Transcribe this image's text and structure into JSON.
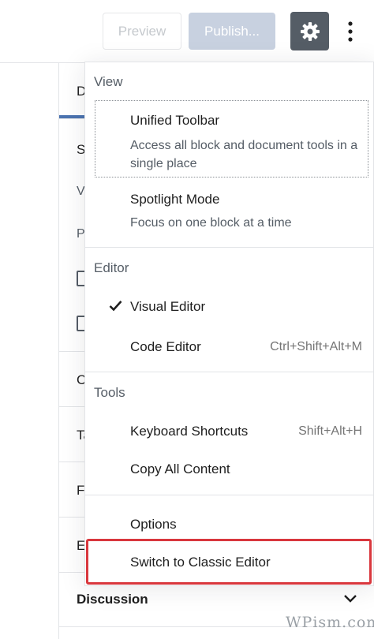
{
  "header": {
    "preview_label": "Preview",
    "publish_label": "Publish...",
    "settings_icon": "gear-icon",
    "more_icon": "vertical-ellipsis-icon"
  },
  "sidebar": {
    "tab_partial": "D",
    "rows": [
      "S",
      "V",
      "P",
      "C",
      "Ta",
      "Fe",
      "E"
    ],
    "discussion_label": "Discussion",
    "discussion_icon": "chevron-down-icon"
  },
  "menu": {
    "view": {
      "label": "View",
      "items": [
        {
          "title": "Unified Toolbar",
          "description": "Access all block and document tools in a single place"
        },
        {
          "title": "Spotlight Mode",
          "description": "Focus on one block at a time"
        }
      ]
    },
    "editor": {
      "label": "Editor",
      "items": [
        {
          "title": "Visual Editor",
          "shortcut": "",
          "checked": true
        },
        {
          "title": "Code Editor",
          "shortcut": "Ctrl+Shift+Alt+M",
          "checked": false
        }
      ]
    },
    "tools": {
      "label": "Tools",
      "items": [
        {
          "title": "Keyboard Shortcuts",
          "shortcut": "Shift+Alt+H"
        },
        {
          "title": "Copy All Content",
          "shortcut": ""
        }
      ]
    },
    "other": {
      "items": [
        {
          "title": "Options"
        },
        {
          "title": "Switch to Classic Editor"
        }
      ]
    }
  },
  "colors": {
    "accent": "#4b73b0",
    "highlight": "#d9373d",
    "settings_bg": "#555d66"
  },
  "watermark": "WPism.com"
}
